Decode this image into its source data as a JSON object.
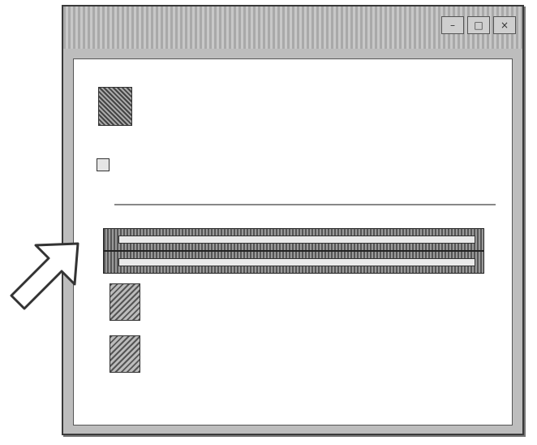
{
  "window": {
    "title": "",
    "controls": {
      "minimize": "–",
      "maximize": "□",
      "close": "×"
    }
  },
  "content": {
    "heading": "",
    "checkbox_label": "",
    "group_label": "",
    "rows": [
      {
        "label": ""
      },
      {
        "label": ""
      }
    ],
    "files": [
      {
        "name": "",
        "detail": ""
      },
      {
        "name": "",
        "detail": ""
      }
    ],
    "footer": ""
  },
  "colors": {
    "window_frame": "#bdbdbd",
    "selection": "#555555",
    "arrow": "#ffffff"
  },
  "icons": {
    "app": "app-icon",
    "file": "document-icon",
    "pointer": "arrow-icon"
  }
}
